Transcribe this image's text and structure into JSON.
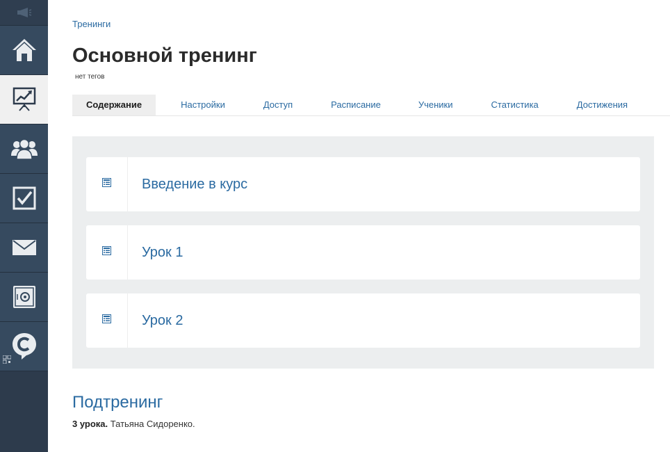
{
  "sidebar": {
    "items": [
      {
        "name": "home"
      },
      {
        "name": "trainings",
        "active": true
      },
      {
        "name": "users"
      },
      {
        "name": "tasks"
      },
      {
        "name": "messages"
      },
      {
        "name": "safe"
      },
      {
        "name": "chat"
      }
    ]
  },
  "breadcrumb": "Тренинги",
  "page": {
    "title": "Основной тренинг",
    "tags": "нет тегов"
  },
  "tabs": [
    {
      "label": "Содержание",
      "active": true
    },
    {
      "label": "Настройки"
    },
    {
      "label": "Доступ"
    },
    {
      "label": "Расписание"
    },
    {
      "label": "Ученики"
    },
    {
      "label": "Статистика"
    },
    {
      "label": "Достижения"
    }
  ],
  "lessons": [
    {
      "title": "Введение в курс",
      "icon": "list-icon"
    },
    {
      "title": "Урок 1",
      "icon": "list-icon"
    },
    {
      "title": "Урок 2",
      "icon": "list-icon"
    }
  ],
  "subtraining": {
    "title": "Подтренинг",
    "count": "3 урока.",
    "author": "Татьяна Сидоренко."
  },
  "colors": {
    "sidebar": "#2d3b4c",
    "link": "#2a6aa1",
    "panel": "#eceeef"
  }
}
